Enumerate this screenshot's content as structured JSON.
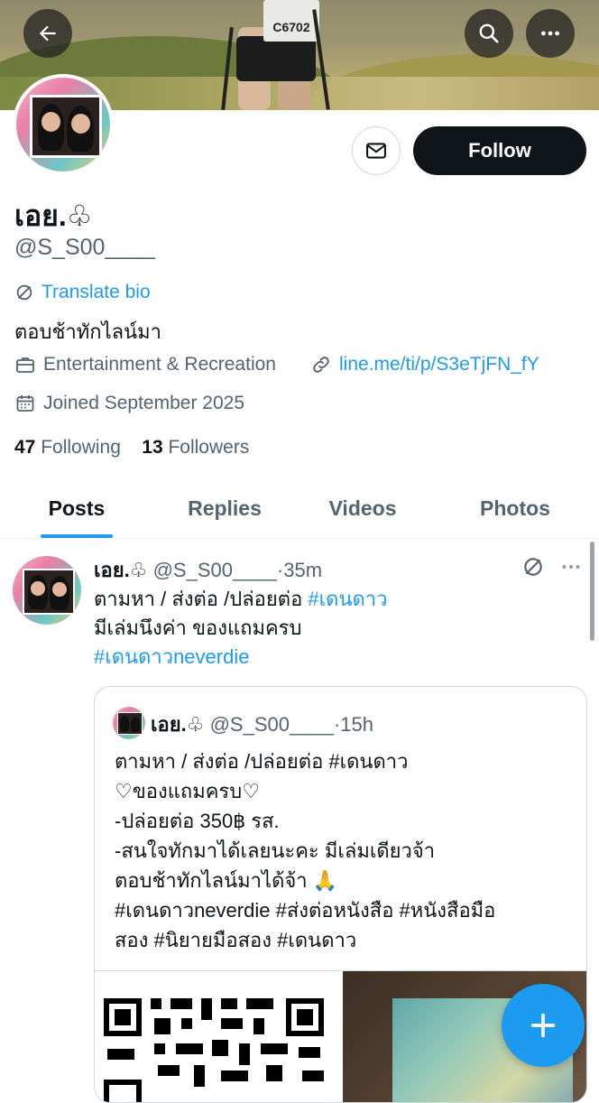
{
  "header": {
    "back_icon": "arrow-left-icon",
    "search_icon": "search-icon",
    "more_icon": "more-horizontal-icon",
    "banner_bib_number": "C6702"
  },
  "profile": {
    "display_name": "เอย.♧",
    "handle": "@S_S00____",
    "translate_bio": "Translate bio",
    "bio": "ตอบช้าทักไลน์มา",
    "category": "Entertainment & Recreation",
    "website": "line.me/ti/p/S3eTjFN_fY",
    "joined": "Joined September 2025",
    "following_count": "47",
    "following_label": "Following",
    "followers_count": "13",
    "followers_label": "Followers",
    "follow_button": "Follow",
    "message_icon": "mail-icon"
  },
  "tabs": [
    {
      "label": "Posts",
      "active": true
    },
    {
      "label": "Replies",
      "active": false
    },
    {
      "label": "Videos",
      "active": false
    },
    {
      "label": "Photos",
      "active": false
    }
  ],
  "tweet": {
    "name": "เอย.♧",
    "handle": "@S_S00____",
    "time": "35m",
    "line1": "ตามหา / ส่งต่อ /ปล่อยต่อ ",
    "line1_tag": "#เดนดาว",
    "line2": " มีเล่มนึงค่า ของแถมครบ",
    "line3_tag": "#เดนดาวneverdie",
    "quote": {
      "name": "เอย.♧",
      "handle": "@S_S00____",
      "time": "15h",
      "lines": [
        "ตามหา / ส่งต่อ /ปล่อยต่อ #เดนดาว",
        "♡ของแถมครบ♡",
        "-ปล่อยต่อ 350฿  รส.",
        "-สนใจทักมาได้เลยนะคะ  มีเล่มเดียวจ้า",
        "ตอบช้าทักไลน์มาได้จ้า 🙏",
        "#เดนดาวneverdie #ส่งต่อหนังสือ #หนังสือมือ",
        "สอง #นิยายมือสอง #เดนดาว"
      ]
    }
  },
  "fab": {
    "icon": "plus-icon"
  },
  "colors": {
    "accent": "#1d9bf0",
    "text": "#0f1419",
    "muted": "#536471"
  }
}
